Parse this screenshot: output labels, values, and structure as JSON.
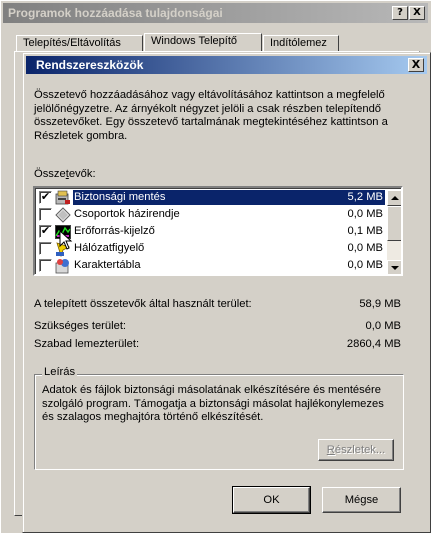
{
  "outer_window": {
    "title": "Programok hozzáadása tulajdonságai",
    "help_label": "?",
    "close_label": "X",
    "tabs": [
      "Telepítés/Eltávolítás",
      "Windows Telepítő",
      "Indítólemez"
    ]
  },
  "dialog": {
    "title": "Rendszereszközök",
    "close_label": "X",
    "description": "Összetevő hozzáadásához vagy eltávolításához kattintson a megfelelő jelölőnégyzetre. Az árnyékolt négyzet jelöli a csak részben telepítendő összetevőket. Egy összetevő tartalmának megtekintéséhez kattintson a Részletek gombra.",
    "components_label_pre": "Össze",
    "components_label_ul": "t",
    "components_label_post": "evők:",
    "components": [
      {
        "name": "Biztonsági mentés",
        "size": "5,2 MB",
        "checked": true,
        "selected": true,
        "icon": "backup-icon"
      },
      {
        "name": "Csoportok házirendje",
        "size": "0,0 MB",
        "checked": false,
        "selected": false,
        "icon": "policy-diamond-icon"
      },
      {
        "name": "Erőforrás-kijelző",
        "size": "0,1 MB",
        "checked": true,
        "selected": false,
        "icon": "resource-meter-icon"
      },
      {
        "name": "Hálózatfigyelő",
        "size": "0,0 MB",
        "checked": false,
        "selected": false,
        "icon": "net-watcher-icon"
      },
      {
        "name": "Karaktertábla",
        "size": "0,0 MB",
        "checked": false,
        "selected": false,
        "icon": "char-map-icon"
      }
    ],
    "stats": {
      "installed_label": "A telepített összetevők által használt terület:",
      "installed_value": "58,9 MB",
      "required_label": "Szükséges terület:",
      "required_value": "0,0 MB",
      "free_label": "Szabad lemezterület:",
      "free_value": "2860,4 MB"
    },
    "group_label": "Leírás",
    "group_text": "Adatok és fájlok biztonsági másolatának elkészítésére és mentésére szolgáló program. Támogatja a biztonsági másolat hajlékonylemezes és szalagos meghajtóra történő elkészítését.",
    "details_button_ul": "R",
    "details_button": "észletek...",
    "ok_button": "OK",
    "cancel_button": "Mégse"
  }
}
